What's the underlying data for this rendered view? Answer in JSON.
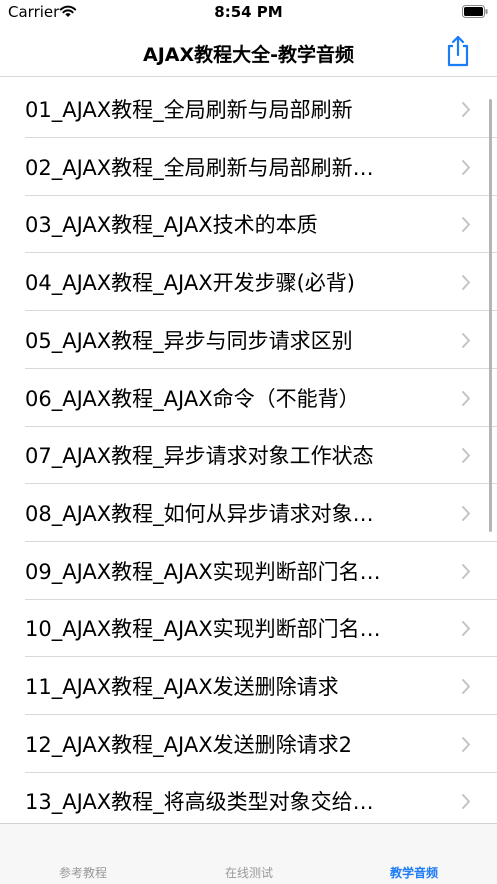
{
  "status": {
    "carrier": "Carrier",
    "time": "8:54 PM"
  },
  "nav": {
    "title": "AJAX教程大全-教学音频"
  },
  "list": [
    "01_AJAX教程_全局刷新与局部刷新",
    "02_AJAX教程_全局刷新与局部刷新…",
    "03_AJAX教程_AJAX技术的本质",
    "04_AJAX教程_AJAX开发步骤(必背)",
    "05_AJAX教程_异步与同步请求区别",
    "06_AJAX教程_AJAX命令（不能背）",
    "07_AJAX教程_异步请求对象工作状态",
    "08_AJAX教程_如何从异步请求对象…",
    "09_AJAX教程_AJAX实现判断部门名…",
    "10_AJAX教程_AJAX实现判断部门名…",
    "11_AJAX教程_AJAX发送删除请求",
    "12_AJAX教程_AJAX发送删除请求2",
    "13_AJAX教程_将高级类型对象交给…"
  ],
  "tabs": [
    {
      "label": "参考教程",
      "active": false
    },
    {
      "label": "在线测试",
      "active": false
    },
    {
      "label": "教学音频",
      "active": true
    }
  ],
  "colors": {
    "accent": "#1b7cf6",
    "tab_inactive": "#999999",
    "chevron": "#c4c4c7"
  }
}
